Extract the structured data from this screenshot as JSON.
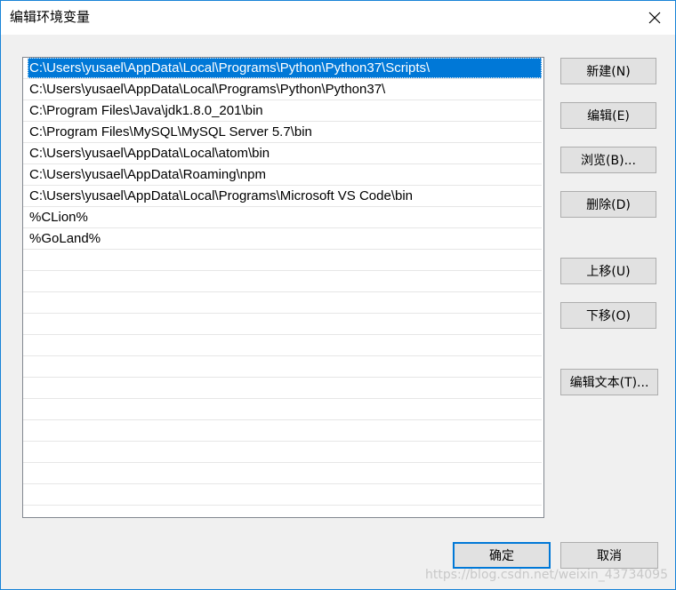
{
  "window": {
    "title": "编辑环境变量"
  },
  "paths": [
    "C:\\Users\\yusael\\AppData\\Local\\Programs\\Python\\Python37\\Scripts\\",
    "C:\\Users\\yusael\\AppData\\Local\\Programs\\Python\\Python37\\",
    "C:\\Program Files\\Java\\jdk1.8.0_201\\bin",
    "C:\\Program Files\\MySQL\\MySQL Server 5.7\\bin",
    "C:\\Users\\yusael\\AppData\\Local\\atom\\bin",
    "C:\\Users\\yusael\\AppData\\Roaming\\npm",
    "C:\\Users\\yusael\\AppData\\Local\\Programs\\Microsoft VS Code\\bin",
    "%CLion%",
    "%GoLand%"
  ],
  "selected_index": 0,
  "buttons": {
    "new": "新建(N)",
    "edit": "编辑(E)",
    "browse": "浏览(B)...",
    "delete": "删除(D)",
    "move_up": "上移(U)",
    "move_down": "下移(O)",
    "edit_text": "编辑文本(T)...",
    "ok": "确定",
    "cancel": "取消"
  },
  "watermark": "https://blog.csdn.net/weixin_43734095",
  "icons": {
    "close": "close-icon"
  },
  "colors": {
    "selection": "#0078d7",
    "accent_border": "#1883d7"
  }
}
